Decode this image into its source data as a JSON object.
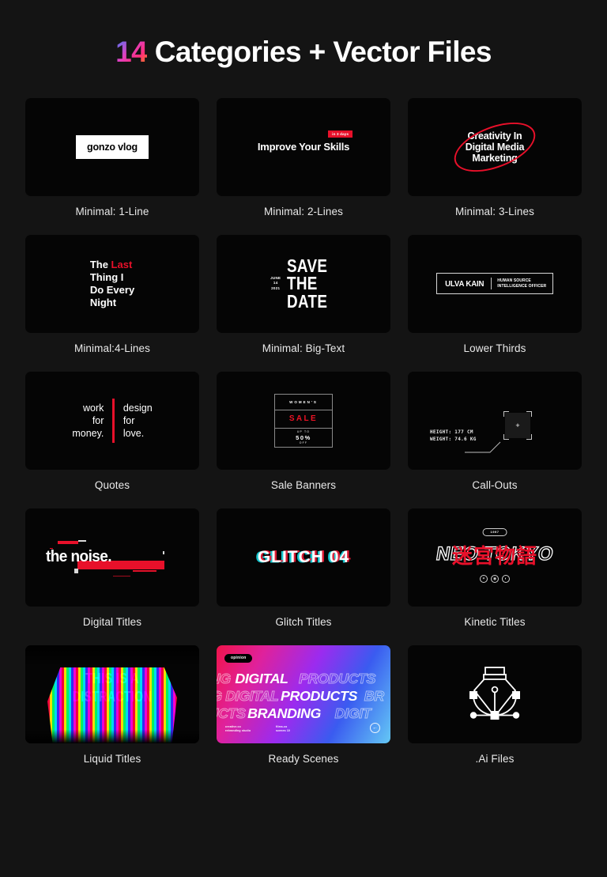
{
  "title": {
    "number": "14",
    "rest": " Categories + Vector Files"
  },
  "colors": {
    "page_background": "#141414",
    "card_background": "#050505",
    "accent_red": "#e8102a",
    "text": "#ffffff",
    "caption": "#e9e9e9",
    "title_gradient": [
      "#2f80ff",
      "#e040c0",
      "#ff2d7a",
      "#ff9a00"
    ]
  },
  "cards": [
    {
      "id": "minimal-1-line",
      "caption": "Minimal: 1-Line",
      "art": {
        "text": "gonzo vlog"
      }
    },
    {
      "id": "minimal-2-lines",
      "caption": "Minimal: 2-Lines",
      "art": {
        "text": "Improve Your Skills",
        "badge": "in 3 days"
      }
    },
    {
      "id": "minimal-3-lines",
      "caption": "Minimal: 3-Lines",
      "art": {
        "line1": "Creativity In",
        "line2": "Digital Media",
        "line3": "Marketing"
      }
    },
    {
      "id": "minimal-4-lines",
      "caption": "Minimal:4-Lines",
      "art": {
        "l1a": "The ",
        "l1b": "Last",
        "l2": "Thing I",
        "l3": "Do Every",
        "l4": "Night"
      }
    },
    {
      "id": "minimal-big-text",
      "caption": "Minimal: Big-Text",
      "art": {
        "month": "JUNE",
        "day": "14",
        "year": "2021",
        "b1": "SAVE",
        "b2": "THE",
        "b3": "DATE"
      }
    },
    {
      "id": "lower-thirds",
      "caption": "Lower Thirds",
      "art": {
        "name": "ULVA KAIN",
        "role1": "HUMAN SOURCE",
        "role2": "INTELLIGENCE OFFICER"
      }
    },
    {
      "id": "quotes",
      "caption": "Quotes",
      "art": {
        "left1": "work",
        "left2": "for",
        "left3": "money.",
        "right1": "design",
        "right2": "for",
        "right3": "love."
      }
    },
    {
      "id": "sale-banners",
      "caption": "Sale Banners",
      "art": {
        "top": "WOMEN'S",
        "mid": "SALE",
        "upto": "UP TO",
        "percent": "50%",
        "off": "OFF"
      }
    },
    {
      "id": "call-outs",
      "caption": "Call-Outs",
      "art": {
        "height": "HEIGHT: 177 CM",
        "weight": "WEIGHT: 74.6 KG",
        "marker": "+"
      }
    },
    {
      "id": "digital-titles",
      "caption": "Digital Titles",
      "art": {
        "text": "the noise."
      }
    },
    {
      "id": "glitch-titles",
      "caption": "Glitch Titles",
      "art": {
        "text": "GLITCH 04"
      }
    },
    {
      "id": "kinetic-titles",
      "caption": "Kinetic Titles",
      "art": {
        "badge": "1997",
        "text": "NEO TOKYO",
        "japanese": "迷宮物語",
        "icon1": "✶",
        "icon2": "◉",
        "icon3": "◐"
      }
    },
    {
      "id": "liquid-titles",
      "caption": "Liquid Titles",
      "art": {
        "line1": "THIS IS A",
        "line2": "DISTRACTION"
      }
    },
    {
      "id": "ready-scenes",
      "caption": "Ready Scenes",
      "art": {
        "badge": "opinion",
        "row1_ghost_left": "NG",
        "row1_solid": "DIGITAL",
        "row1_ghost_right": "PRODUCTS",
        "row2_ghost_left": "G DIGITAL",
        "row2_solid": "PRODUCTS",
        "row2_ghost_right": "BR",
        "row3_ghost_left": "UCTS",
        "row3_solid": "BRANDING",
        "row3_ghost_right": "DIGIT",
        "meta1a": "creative.co",
        "meta1b": "rebranding studio",
        "meta2a": "films.co",
        "meta2b": "scenes 10",
        "arrow": "←"
      }
    },
    {
      "id": "ai-files",
      "caption": ".Ai Files",
      "art": {
        "icon": "pen-tool-bezier-icon"
      }
    }
  ]
}
